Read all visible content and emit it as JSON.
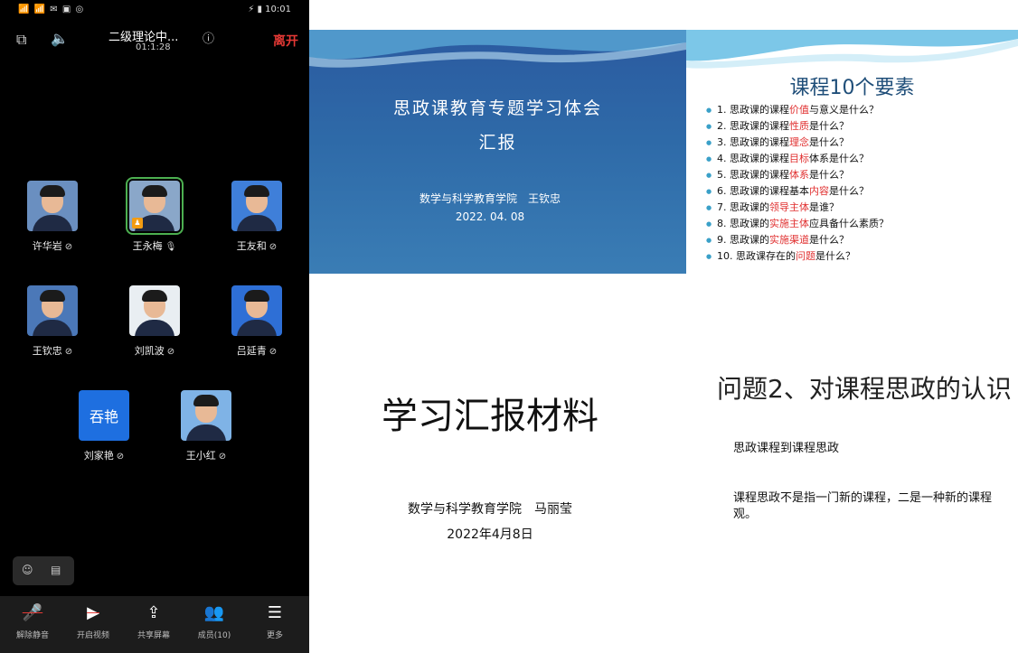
{
  "phone": {
    "status_left": "📶 📶 ✉ ▣ ◎",
    "status_right": "⚡ ▮ 10:01",
    "meeting_title": "二级理论中...",
    "meeting_timer": "01:1:28",
    "leave_label": "离开",
    "participants": [
      {
        "name": "许华岩",
        "avatar_type": "photo",
        "speaking": false,
        "host": false
      },
      {
        "name": "王永梅",
        "avatar_type": "photo",
        "speaking": true,
        "host": true
      },
      {
        "name": "王友和",
        "avatar_type": "photo",
        "speaking": false,
        "host": false
      },
      {
        "name": "王钦忠",
        "avatar_type": "photo",
        "speaking": false,
        "host": false
      },
      {
        "name": "刘凯波",
        "avatar_type": "photo",
        "speaking": false,
        "host": false
      },
      {
        "name": "吕延青",
        "avatar_type": "photo",
        "speaking": false,
        "host": false
      },
      {
        "name": "刘家艳",
        "avatar_type": "text",
        "avatar_text": "吞艳",
        "speaking": false,
        "host": false
      },
      {
        "name": "王小红",
        "avatar_type": "photo",
        "speaking": false,
        "host": false
      }
    ],
    "toolbar": [
      {
        "label": "解除静音",
        "icon": "mic-off-icon"
      },
      {
        "label": "开启视频",
        "icon": "video-off-icon"
      },
      {
        "label": "共享屏幕",
        "icon": "share-screen-icon"
      },
      {
        "label": "成员(10)",
        "icon": "members-icon"
      },
      {
        "label": "更多",
        "icon": "menu-icon"
      }
    ]
  },
  "slide1": {
    "title_line1": "思政课教育专题学习体会",
    "title_line2": "汇报",
    "author": "数学与科学教育学院　王钦忠",
    "date": "2022. 04. 08"
  },
  "slide2": {
    "title": "课程10个要素",
    "items": [
      {
        "pre": "1. 思政课的课程",
        "hl": "价值",
        "post": "与意义是什么？"
      },
      {
        "pre": "2. 思政课的课程",
        "hl": "性质",
        "post": "是什么？"
      },
      {
        "pre": "3. 思政课的课程",
        "hl": "理念",
        "post": "是什么？"
      },
      {
        "pre": "4. 思政课的课程",
        "hl": "目标",
        "post": "体系是什么？"
      },
      {
        "pre": "5. 思政课的课程",
        "hl": "体系",
        "post": "是什么？"
      },
      {
        "pre": "6. 思政课的课程基本",
        "hl": "内容",
        "post": "是什么？"
      },
      {
        "pre": "7. 思政课的",
        "hl": "领导主体",
        "post": "是谁？"
      },
      {
        "pre": "8. 思政课的",
        "hl": "实施主体",
        "post": "应具备什么素质？"
      },
      {
        "pre": "9. 思政课的",
        "hl": "实施渠道",
        "post": "是什么？"
      },
      {
        "pre": "10. 思政课存在的",
        "hl": "问题",
        "post": "是什么？"
      }
    ]
  },
  "slide3": {
    "title": "学习汇报材料",
    "author": "数学与科学教育学院　马丽莹",
    "date": "2022年4月8日"
  },
  "slide4": {
    "title": "问题2、对课程思政的认识",
    "p1": "思政课程到课程思政",
    "p2": "课程思政不是指一门新的课程，二是一种新的课程观。"
  }
}
